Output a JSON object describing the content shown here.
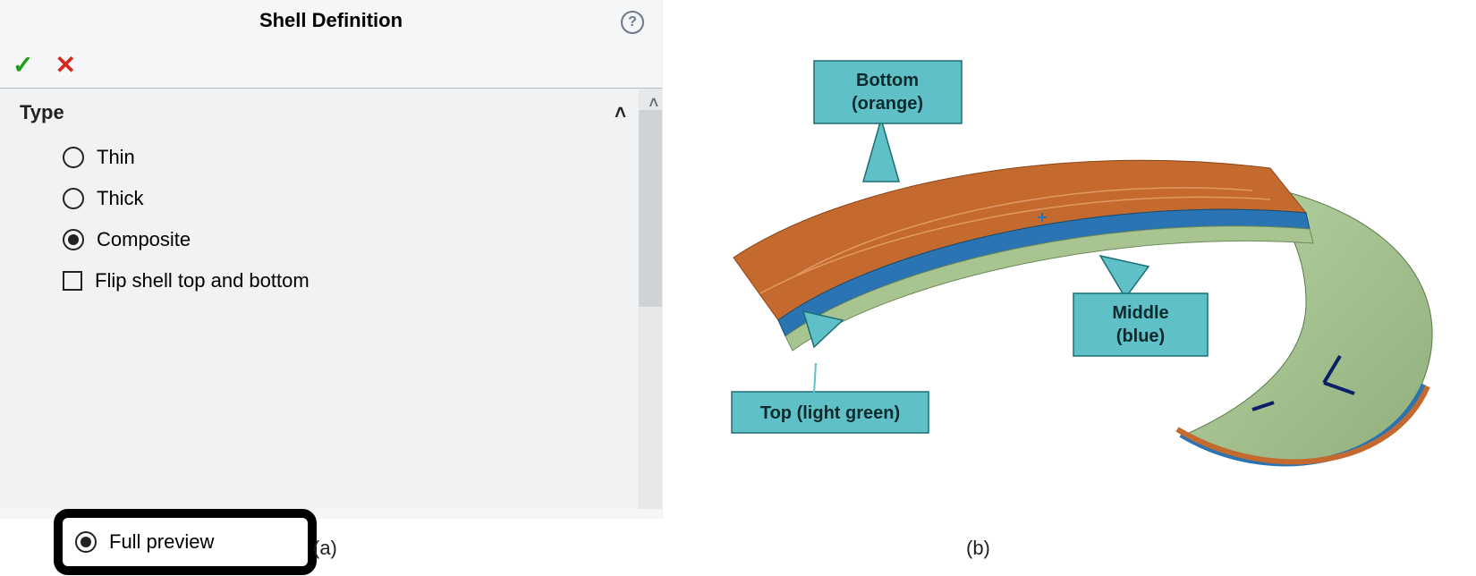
{
  "panel": {
    "title": "Shell Definition",
    "help_tooltip": "?",
    "ok_icon": "✓",
    "cancel_icon": "✕",
    "section_label": "Type",
    "options": {
      "thin": "Thin",
      "thick": "Thick",
      "composite": "Composite",
      "flip": "Flip shell top and bottom",
      "full_preview": "Full preview"
    }
  },
  "callouts": {
    "bottom_line1": "Bottom",
    "bottom_line2": "(orange)",
    "middle_line1": "Middle",
    "middle_line2": "(blue)",
    "top": "Top (light green)"
  },
  "layers": {
    "bottom_color": "#c46a2e",
    "middle_color": "#2a74b3",
    "top_color": "#a8c490"
  },
  "captions": {
    "a": "(a)",
    "b": "(b)"
  }
}
